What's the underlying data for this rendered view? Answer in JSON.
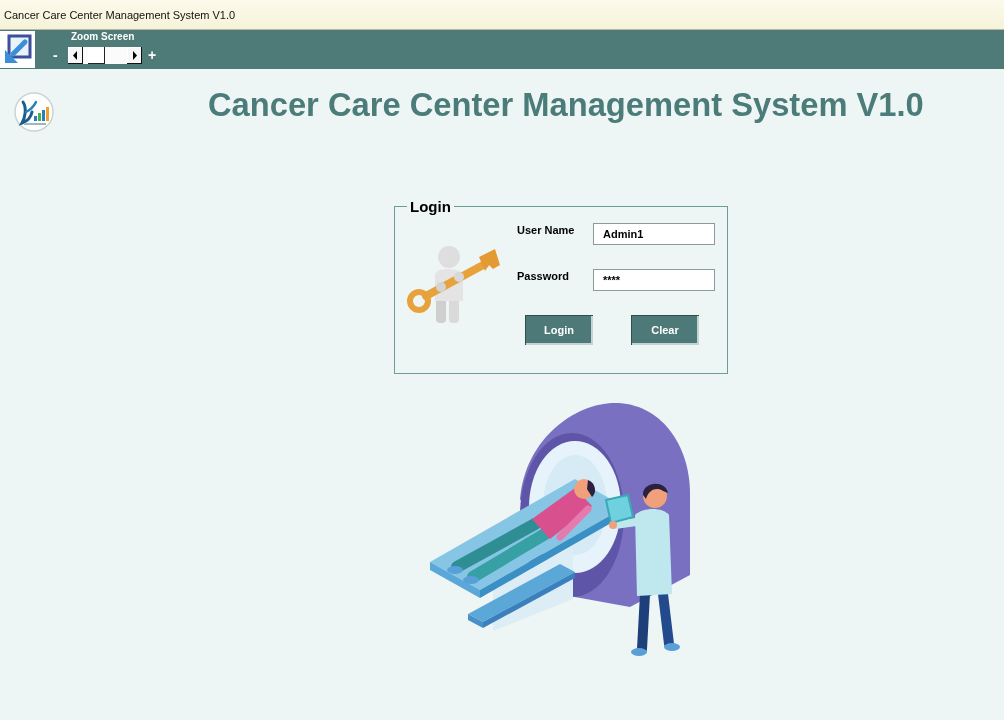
{
  "window": {
    "title": "Cancer Care Center Management System V1.0"
  },
  "toolbar": {
    "zoom": {
      "label": "Zoom Screen",
      "decrease": "-",
      "increase": "+",
      "level": 0.2
    }
  },
  "header": {
    "title": "Cancer Care Center Management System V1.0"
  },
  "login": {
    "legend": "Login",
    "fields": [
      {
        "label": "User Name",
        "value": "Admin1"
      },
      {
        "label": "Password",
        "value": "****"
      }
    ],
    "buttons": [
      "Login",
      "Clear"
    ]
  }
}
